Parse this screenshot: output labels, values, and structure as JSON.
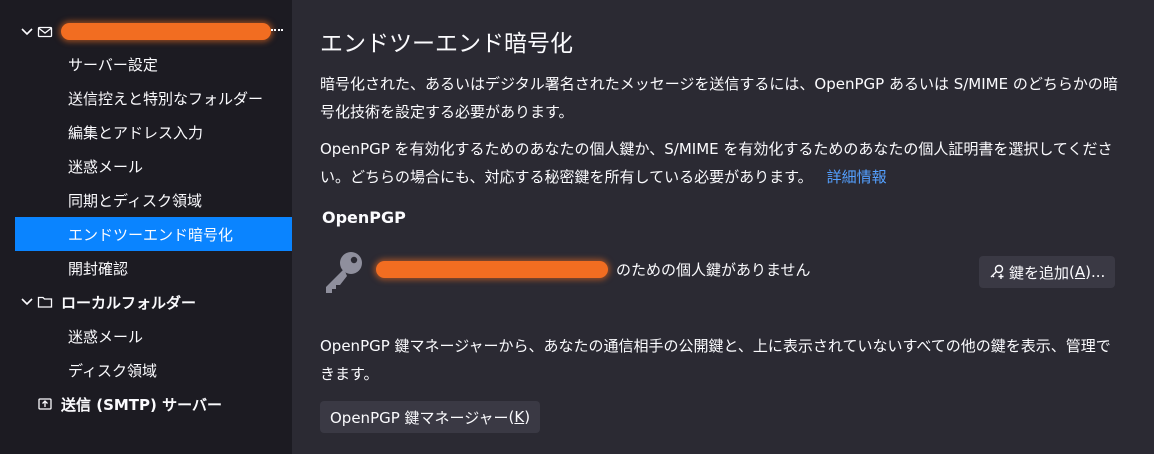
{
  "sidebar": {
    "account": {
      "twisty": "expanded",
      "icon": "mail-icon"
    },
    "account_items": [
      {
        "label": "サーバー設定"
      },
      {
        "label": "送信控えと特別なフォルダー"
      },
      {
        "label": "編集とアドレス入力"
      },
      {
        "label": "迷惑メール"
      },
      {
        "label": "同期とディスク領域"
      },
      {
        "label": "エンドツーエンド暗号化",
        "selected": true
      },
      {
        "label": "開封確認"
      }
    ],
    "local_folders": {
      "label": "ローカルフォルダー",
      "twisty": "expanded",
      "icon": "folder-icon"
    },
    "local_items": [
      {
        "label": "迷惑メール"
      },
      {
        "label": "ディスク領域"
      }
    ],
    "smtp": {
      "label": "送信 (SMTP) サーバー",
      "icon": "smtp-icon"
    }
  },
  "main": {
    "title": "エンドツーエンド暗号化",
    "intro": "暗号化された、あるいはデジタル署名されたメッセージを送信するには、OpenPGP あるいは S/MIME のどちらかの暗号化技術を設定する必要があります。",
    "intro2": "OpenPGP を有効化するためのあなたの個人鍵か、S/MIME を有効化するためのあなたの個人証明書を選択してください。どちらの場合にも、対応する秘密鍵を所有している必要があります。",
    "learn_more": "詳細情報",
    "openpgp_heading": "OpenPGP",
    "no_key_text": "のための個人鍵がありません",
    "add_key_button": "鍵を追加",
    "add_key_accesskey": "A",
    "add_key_suffix": "...",
    "manager_text": "OpenPGP 鍵マネージャーから、あなたの通信相手の公開鍵と、上に表示されていないすべての他の鍵を表示、管理できます。",
    "manager_button": "OpenPGP 鍵マネージャー",
    "manager_accesskey": "K"
  },
  "colors": {
    "sidebar_bg": "#1c1b22",
    "main_bg": "#2b2a33",
    "selected": "#0a84ff",
    "link": "#54a0ff",
    "redaction": "#f26d21"
  }
}
